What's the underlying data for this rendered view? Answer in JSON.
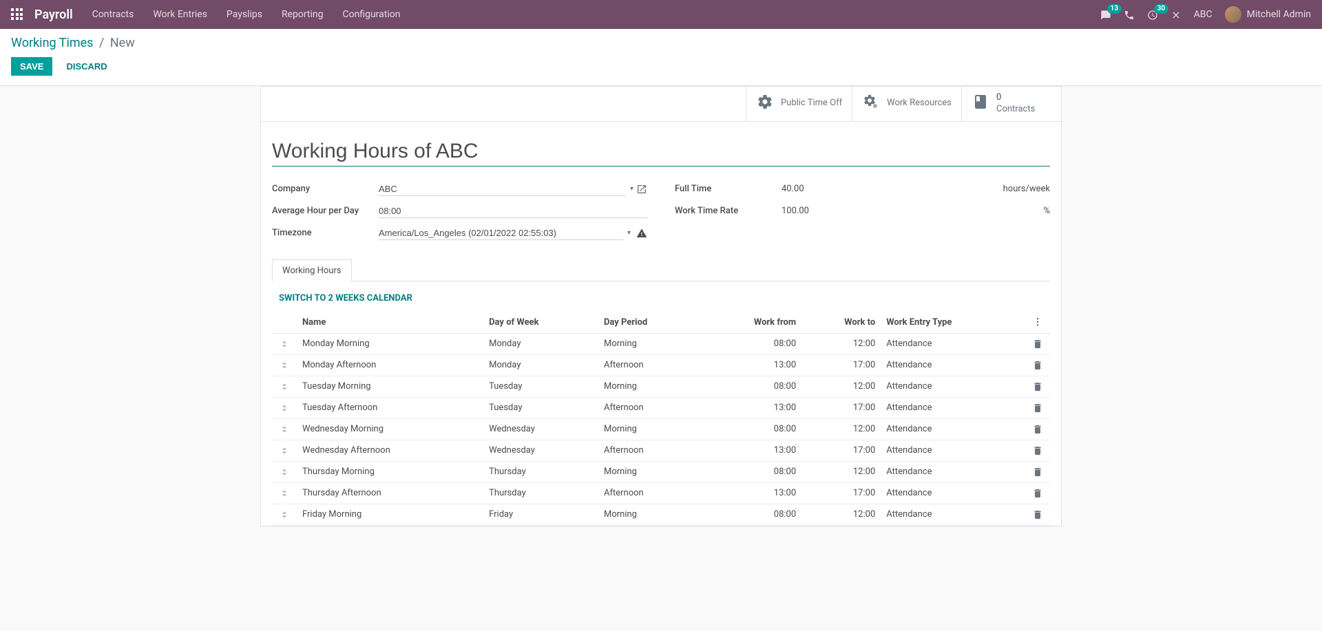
{
  "navbar": {
    "brand": "Payroll",
    "menu": [
      "Contracts",
      "Work Entries",
      "Payslips",
      "Reporting",
      "Configuration"
    ],
    "msg_badge": "13",
    "activity_badge": "30",
    "company": "ABC",
    "user": "Mitchell Admin"
  },
  "breadcrumb": {
    "parent": "Working Times",
    "current": "New"
  },
  "actions": {
    "save": "SAVE",
    "discard": "DISCARD"
  },
  "stat_buttons": {
    "timeoff": "Public Time Off",
    "resources": "Work Resources",
    "contracts_count": "0",
    "contracts_label": "Contracts"
  },
  "form": {
    "title": "Working Hours of ABC",
    "labels": {
      "company": "Company",
      "avg_hour": "Average Hour per Day",
      "timezone": "Timezone",
      "full_time": "Full Time",
      "work_time_rate": "Work Time Rate"
    },
    "values": {
      "company": "ABC",
      "avg_hour": "08:00",
      "timezone": "America/Los_Angeles (02/01/2022 02:55:03)",
      "full_time": "40.00",
      "work_time_rate": "100.00"
    },
    "units": {
      "full_time": "hours/week",
      "work_time_rate": "%"
    }
  },
  "tabs": {
    "working_hours": "Working Hours"
  },
  "switch_link": "SWITCH TO 2 WEEKS CALENDAR",
  "table": {
    "headers": {
      "name": "Name",
      "day_of_week": "Day of Week",
      "day_period": "Day Period",
      "work_from": "Work from",
      "work_to": "Work to",
      "work_entry_type": "Work Entry Type"
    },
    "rows": [
      {
        "name": "Monday Morning",
        "day": "Monday",
        "period": "Morning",
        "from": "08:00",
        "to": "12:00",
        "type": "Attendance"
      },
      {
        "name": "Monday Afternoon",
        "day": "Monday",
        "period": "Afternoon",
        "from": "13:00",
        "to": "17:00",
        "type": "Attendance"
      },
      {
        "name": "Tuesday Morning",
        "day": "Tuesday",
        "period": "Morning",
        "from": "08:00",
        "to": "12:00",
        "type": "Attendance"
      },
      {
        "name": "Tuesday Afternoon",
        "day": "Tuesday",
        "period": "Afternoon",
        "from": "13:00",
        "to": "17:00",
        "type": "Attendance"
      },
      {
        "name": "Wednesday Morning",
        "day": "Wednesday",
        "period": "Morning",
        "from": "08:00",
        "to": "12:00",
        "type": "Attendance"
      },
      {
        "name": "Wednesday Afternoon",
        "day": "Wednesday",
        "period": "Afternoon",
        "from": "13:00",
        "to": "17:00",
        "type": "Attendance"
      },
      {
        "name": "Thursday Morning",
        "day": "Thursday",
        "period": "Morning",
        "from": "08:00",
        "to": "12:00",
        "type": "Attendance"
      },
      {
        "name": "Thursday Afternoon",
        "day": "Thursday",
        "period": "Afternoon",
        "from": "13:00",
        "to": "17:00",
        "type": "Attendance"
      },
      {
        "name": "Friday Morning",
        "day": "Friday",
        "period": "Morning",
        "from": "08:00",
        "to": "12:00",
        "type": "Attendance"
      }
    ]
  }
}
